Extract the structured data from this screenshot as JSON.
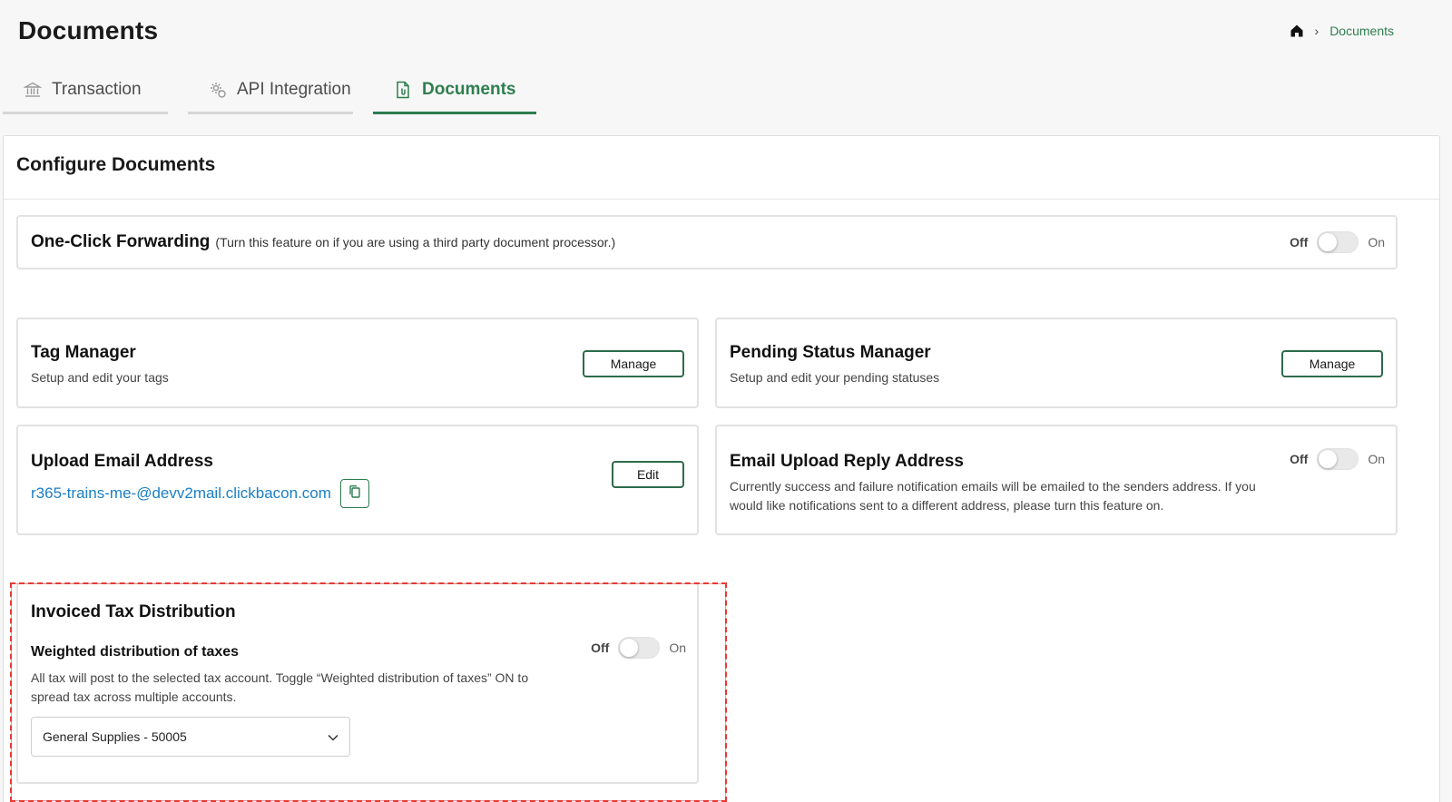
{
  "page": {
    "title": "Documents"
  },
  "breadcrumb": {
    "current": "Documents"
  },
  "tabs": [
    {
      "label": "Transaction",
      "icon": "bank-icon"
    },
    {
      "label": "API Integration",
      "icon": "gear-icon"
    },
    {
      "label": "Documents",
      "icon": "document-icon"
    }
  ],
  "panel": {
    "title": "Configure Documents"
  },
  "one_click": {
    "title": "One-Click Forwarding",
    "note": "(Turn this feature on if you are using a third party document processor.)",
    "off": "Off",
    "on": "On",
    "enabled": false
  },
  "tag_manager": {
    "title": "Tag Manager",
    "subtitle": "Setup and edit your tags",
    "button": "Manage"
  },
  "pending_status": {
    "title": "Pending Status Manager",
    "subtitle": "Setup and edit your pending statuses",
    "button": "Manage"
  },
  "upload_email": {
    "title": "Upload Email Address",
    "email": "r365-trains-me-@devv2mail.clickbacon.com",
    "button": "Edit"
  },
  "reply_address": {
    "title": "Email Upload Reply Address",
    "description": "Currently success and failure notification emails will be emailed to the senders address. If you would like notifications sent to a different address, please turn this feature on.",
    "off": "Off",
    "on": "On",
    "enabled": false
  },
  "tax_distribution": {
    "title": "Invoiced Tax Distribution",
    "subtitle": "Weighted distribution of taxes",
    "description": "All tax will post to the selected tax account. Toggle “Weighted distribution of taxes” ON to spread tax across multiple accounts.",
    "off": "Off",
    "on": "On",
    "enabled": false,
    "selected_account": "General Supplies - 50005"
  },
  "colors": {
    "accent": "#2e7d4f",
    "link": "#1a7fc6",
    "highlight": "#e53935"
  }
}
